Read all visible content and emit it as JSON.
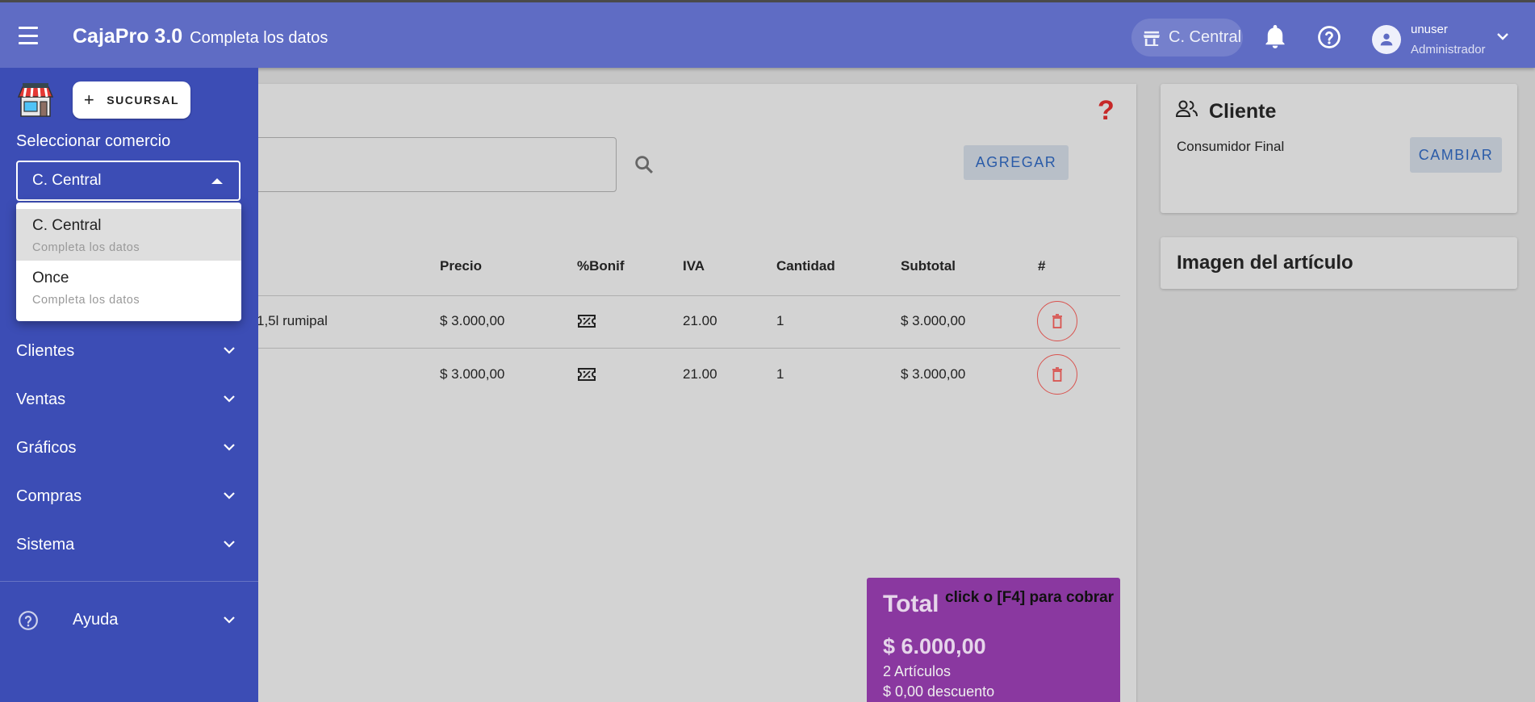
{
  "topbar": {
    "app_title": "CajaPro 3.0",
    "app_subtitle": "Completa los datos",
    "branch": "C. Central",
    "user_name": "unuser",
    "user_role": "Administrador"
  },
  "sidebar": {
    "add_branch_label": "SUCURSAL",
    "select_label": "Seleccionar comercio",
    "selected_store": "C. Central",
    "dropdown_options": [
      {
        "title": "C. Central",
        "subtitle": "Completa los datos"
      },
      {
        "title": "Once",
        "subtitle": "Completa los datos"
      }
    ],
    "nav_items": [
      "Clientes",
      "Ventas",
      "Gráficos",
      "Compras",
      "Sistema"
    ],
    "help_label": "Ayuda"
  },
  "main": {
    "help_symbol": "?",
    "add_button": "AGREGAR",
    "table_headers": [
      "Precio",
      "%Bonif",
      "IVA",
      "Cantidad",
      "Subtotal",
      "#"
    ],
    "rows": [
      {
        "desc": "1,5l rumipal",
        "precio": "$ 3.000,00",
        "iva": "21.00",
        "cantidad": "1",
        "subtotal": "$ 3.000,00"
      },
      {
        "desc": "",
        "precio": "$ 3.000,00",
        "iva": "21.00",
        "cantidad": "1",
        "subtotal": "$ 3.000,00"
      }
    ],
    "total": {
      "label": "Total",
      "hint": "click o [F4] para cobrar",
      "amount": "$ 6.000,00",
      "items": "2 Artículos",
      "discount": "$ 0,00 descuento"
    }
  },
  "cliente": {
    "title": "Cliente",
    "name": "Consumidor Final",
    "change_button": "CAMBIAR"
  },
  "imagen": {
    "title": "Imagen del artículo"
  },
  "colors": {
    "topbar": "#5f6cc4",
    "sidebar": "#3c4db5",
    "total_card": "#8a38a0",
    "accent_button_text": "#2a5ba8",
    "delete_red": "#d9534f"
  }
}
